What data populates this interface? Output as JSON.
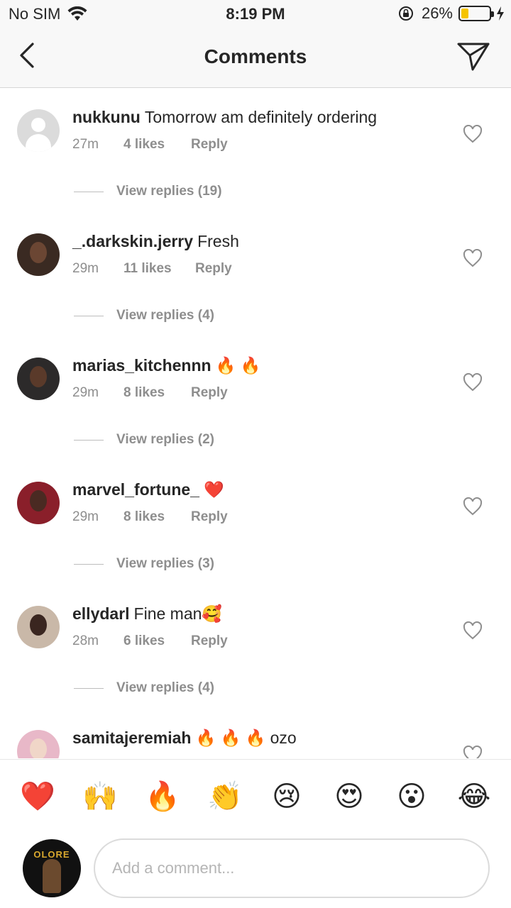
{
  "status_bar": {
    "carrier": "No SIM",
    "time": "8:19 PM",
    "battery": "26%",
    "battery_level": 0.26,
    "battery_color": "#f5c400"
  },
  "header": {
    "title": "Comments",
    "back_icon": "chevron-left-icon",
    "send_icon": "paper-plane-icon"
  },
  "comments": [
    {
      "username": "nukkunu",
      "text": "Tomorrow am definitely ordering",
      "time": "27m",
      "likes": "4 likes",
      "reply": "Reply",
      "view_replies": "View replies (19)"
    },
    {
      "username": "_.darkskin.jerry",
      "text": "Fresh",
      "time": "29m",
      "likes": "11 likes",
      "reply": "Reply",
      "view_replies": "View replies (4)"
    },
    {
      "username": "marias_kitchennn",
      "text": "🔥 🔥",
      "time": "29m",
      "likes": "8 likes",
      "reply": "Reply",
      "view_replies": "View replies (2)"
    },
    {
      "username": "marvel_fortune_",
      "text": "❤️",
      "time": "29m",
      "likes": "8 likes",
      "reply": "Reply",
      "view_replies": "View replies (3)"
    },
    {
      "username": "ellydarl",
      "text": "Fine man🥰",
      "time": "28m",
      "likes": "6 likes",
      "reply": "Reply",
      "view_replies": "View replies (4)"
    },
    {
      "username": "samitajeremiah",
      "text": "🔥 🔥 🔥 ozo"
    }
  ],
  "quick_reactions": [
    "❤️",
    "🙌",
    "🔥",
    "👏",
    "😢",
    "😍",
    "😮",
    "😂"
  ],
  "composer": {
    "placeholder": "Add a comment...",
    "avatar_text": "OLORE"
  }
}
